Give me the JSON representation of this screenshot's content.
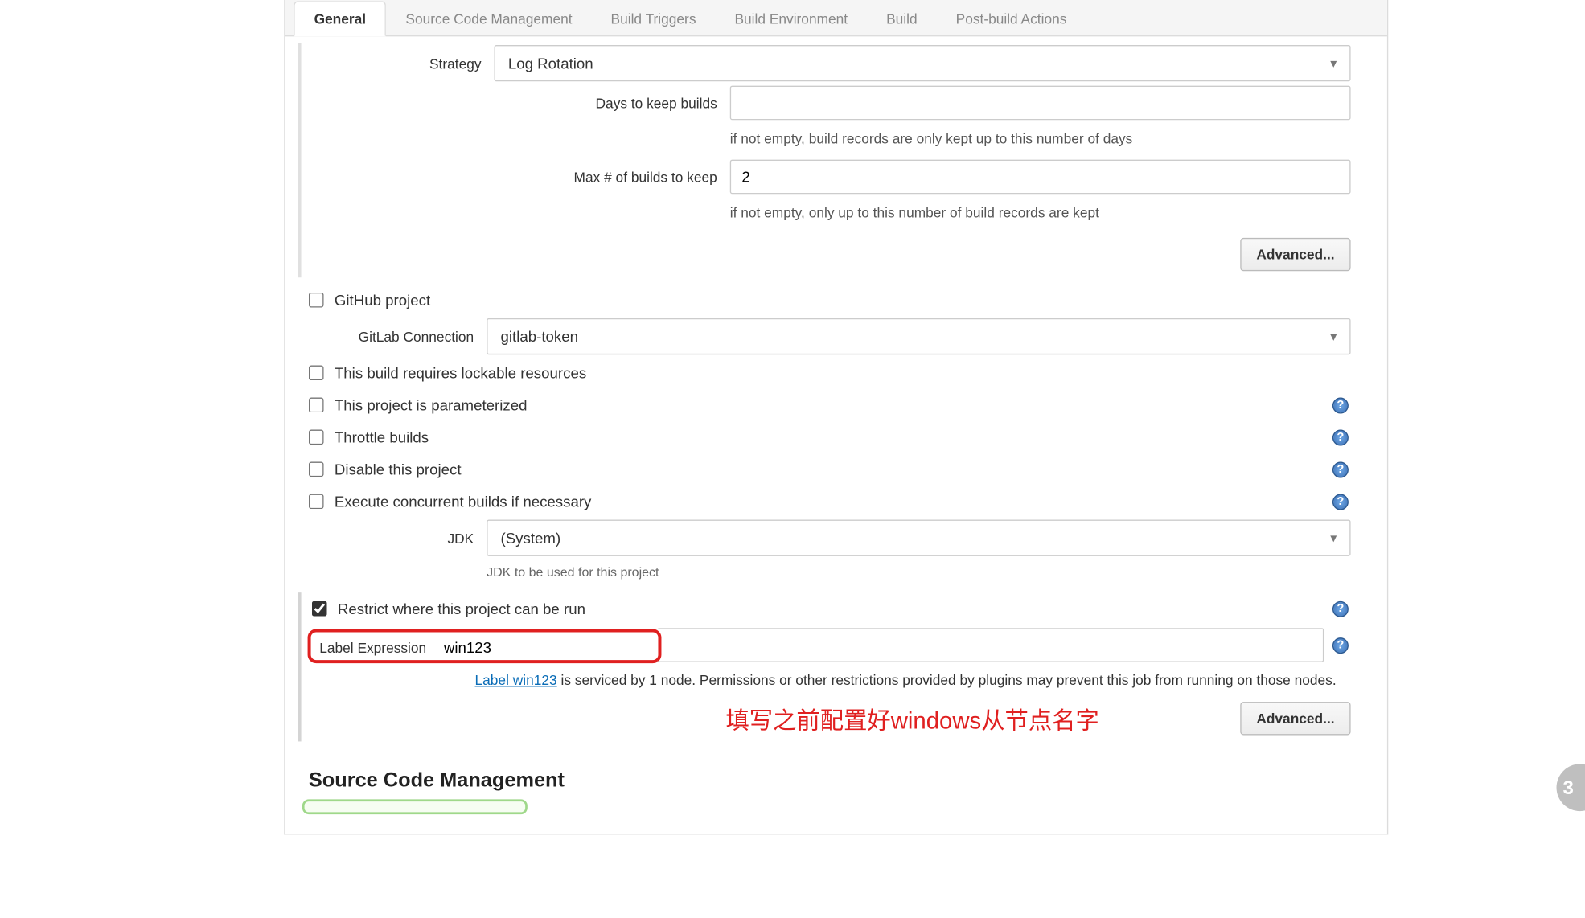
{
  "tabs": [
    {
      "id": "general",
      "label": "General",
      "active": true
    },
    {
      "id": "scm",
      "label": "Source Code Management",
      "active": false
    },
    {
      "id": "triggers",
      "label": "Build Triggers",
      "active": false
    },
    {
      "id": "env",
      "label": "Build Environment",
      "active": false
    },
    {
      "id": "build",
      "label": "Build",
      "active": false
    },
    {
      "id": "post",
      "label": "Post-build Actions",
      "active": false
    }
  ],
  "strategy": {
    "label": "Strategy",
    "value": "Log Rotation"
  },
  "daysKeep": {
    "label": "Days to keep builds",
    "value": "",
    "hint": "if not empty, build records are only kept up to this number of days"
  },
  "maxKeep": {
    "label": "Max # of builds to keep",
    "value": "2",
    "hint": "if not empty, only up to this number of build records are kept"
  },
  "advanced": "Advanced...",
  "checks": {
    "github": "GitHub project",
    "lockable": "This build requires lockable resources",
    "param": "This project is parameterized",
    "throttle": "Throttle builds",
    "disable": "Disable this project",
    "concurrent": "Execute concurrent builds if necessary",
    "restrict": "Restrict where this project can be run"
  },
  "gitlab": {
    "label": "GitLab Connection",
    "value": "gitlab-token"
  },
  "jdk": {
    "label": "JDK",
    "value": "(System)",
    "hint": "JDK to be used for this project"
  },
  "labelExpr": {
    "label": "Label Expression",
    "value": "win123",
    "linkText": "Label win123",
    "msg": " is serviced by 1 node. Permissions or other restrictions provided by plugins may prevent this job from running on those nodes."
  },
  "annotations": {
    "red": "填写之前配置好windows从节点名字"
  },
  "scmHeading": "Source Code Management"
}
